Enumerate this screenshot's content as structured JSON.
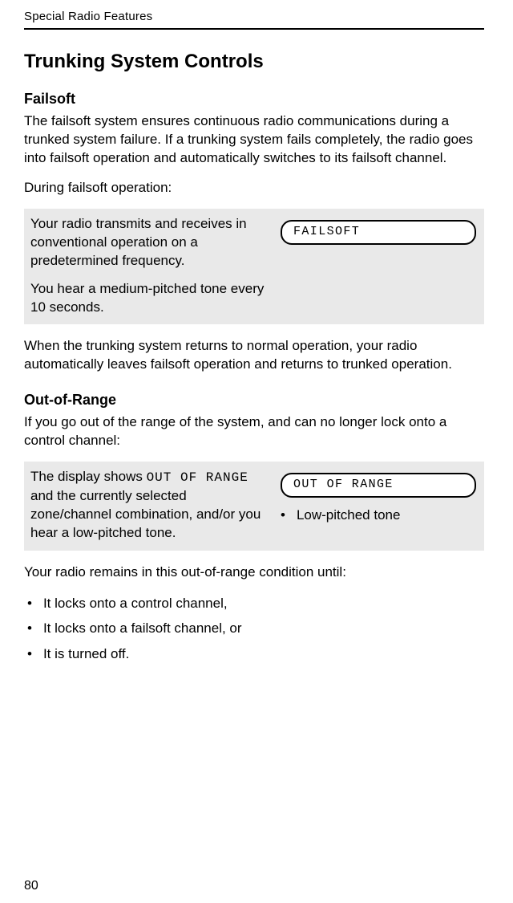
{
  "header": {
    "running_head": "Special Radio Features"
  },
  "section": {
    "title": "Trunking System Controls",
    "failsoft": {
      "heading": "Failsoft",
      "intro": "The failsoft system ensures continuous radio communications during a trunked system failure. If a trunking system fails completely, the radio goes into failsoft operation and automatically switches to its failsoft channel.",
      "lead": "During failsoft operation:",
      "box_text_1": "Your radio transmits and receives in conventional operation on a predetermined frequency.",
      "box_text_2": "You hear a medium-pitched tone every 10 seconds.",
      "display_text": "FAILSOFT",
      "outro": "When the trunking system returns to normal operation, your radio automatically leaves failsoft operation and returns to trunked operation."
    },
    "out_of_range": {
      "heading": "Out-of-Range",
      "intro": "If you go out of the range of the system, and can no longer lock onto a control channel:",
      "box_text_prefix": "The display shows ",
      "box_text_mono": "OUT OF RANGE",
      "box_text_suffix": " and the currently selected zone/channel combination, and/or you hear a low-pitched tone.",
      "display_text": "OUT OF RANGE",
      "tone_bullet": "•",
      "tone_label": "Low-pitched tone",
      "tail_lead": "Your radio remains in this out-of-range condition until:",
      "bullets": [
        "It locks onto a control channel,",
        "It locks onto a failsoft channel, or",
        "It is turned off."
      ]
    }
  },
  "page_number": "80"
}
